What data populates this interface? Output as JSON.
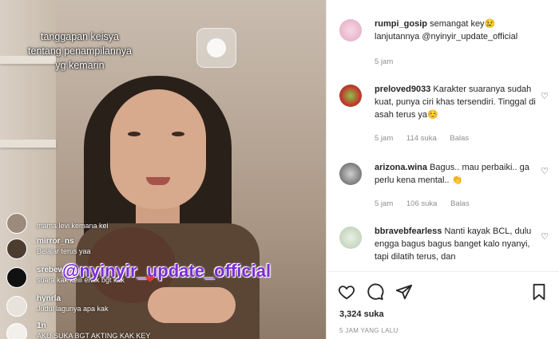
{
  "video": {
    "caption_lines": [
      "tanggapan keisya",
      "tentang penampilannya",
      "yg kemarin"
    ],
    "watermark": "@nyinyir_update_official",
    "live_comments": [
      {
        "user": "",
        "text": "mama levi kemana kei"
      },
      {
        "user": "mirror_ns",
        "text": "Belajar terus yaa"
      },
      {
        "user": "srebew",
        "text": "suara kak keiii enkk bgt kak"
      },
      {
        "user": "hynrla",
        "text": "Judul lagunya apa kak"
      },
      {
        "user": "1n",
        "text": "AKU SUKA BGT AKTING KAK KEY"
      }
    ]
  },
  "comments": [
    {
      "user": "rumpi_gosip",
      "text": "semangat key😢 lanjutannya @nyinyir_update_official",
      "time": "5 jam",
      "likes": "",
      "reply": ""
    },
    {
      "user": "preloved9033",
      "text": "Karakter suaranya sudah kuat, punya ciri khas tersendiri. Tinggal di asah terus ya☺️",
      "time": "5 jam",
      "likes": "114 suka",
      "reply": "Balas"
    },
    {
      "user": "arizona.wina",
      "text": "Bagus.. mau perbaiki.. ga perlu kena mental.. 👏",
      "time": "5 jam",
      "likes": "106 suka",
      "reply": "Balas"
    },
    {
      "user": "bbravebfearless",
      "text": "Nanti kayak BCL, dulu engga bagus bagus banget kalo nyanyi, tapi dilatih terus, dan",
      "time": "",
      "likes": "",
      "reply": ""
    }
  ],
  "actions": {
    "like_icon": "heart-icon",
    "comment_icon": "comment-icon",
    "share_icon": "send-icon",
    "save_icon": "bookmark-icon"
  },
  "post": {
    "likes": "3,324 suka",
    "timestamp": "5 JAM YANG LALU"
  }
}
